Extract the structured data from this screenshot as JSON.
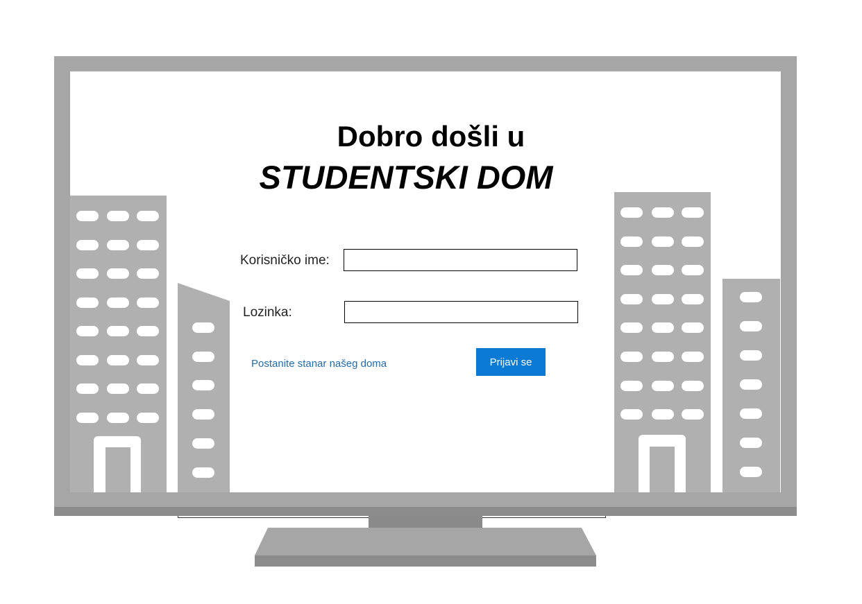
{
  "header": {
    "welcome_line": "Dobro došli u",
    "app_name": "STUDENTSKI DOM"
  },
  "login_form": {
    "username_label": "Korisničko ime:",
    "username_value": "",
    "password_label": "Lozinka:",
    "password_value": "",
    "register_link": "Postanite stanar našeg doma",
    "submit_label": "Prijavi se"
  },
  "colors": {
    "accent": "#0a7ad4",
    "link": "#1f6cb0",
    "monitor": "#a6a6a6",
    "building": "#b0b0b0"
  }
}
